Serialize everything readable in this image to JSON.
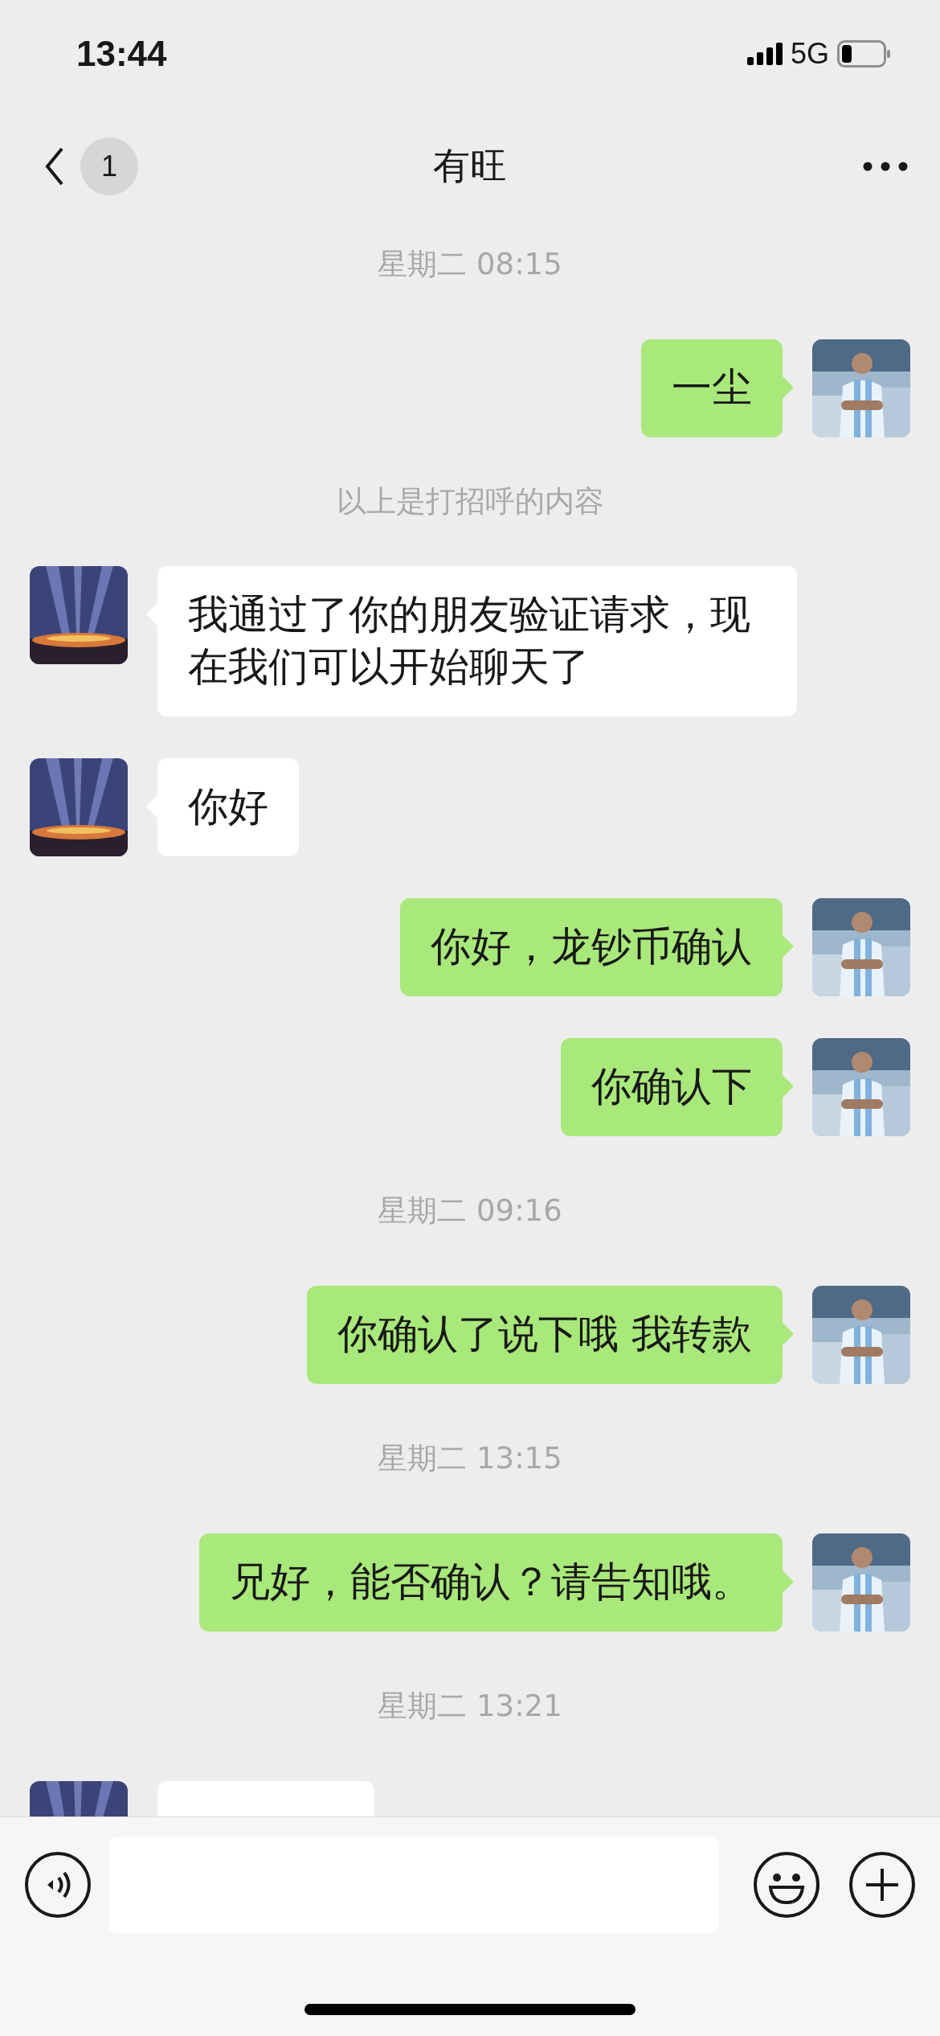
{
  "status_bar": {
    "time": "13:44",
    "network": "5G"
  },
  "header": {
    "badge": "1",
    "title": "有旺"
  },
  "messages": [
    {
      "kind": "timestamp",
      "text": "星期二 08:15"
    },
    {
      "kind": "sent",
      "text": "一尘"
    },
    {
      "kind": "notice",
      "text": "以上是打招呼的内容"
    },
    {
      "kind": "received",
      "text": "我通过了你的朋友验证请求，现在我们可以开始聊天了"
    },
    {
      "kind": "received",
      "text": "你好"
    },
    {
      "kind": "sent",
      "text": "你好，龙钞币确认"
    },
    {
      "kind": "sent",
      "text": "你确认下"
    },
    {
      "kind": "timestamp",
      "text": "星期二 09:16"
    },
    {
      "kind": "sent",
      "text": "你确认了说下哦 我转款"
    },
    {
      "kind": "timestamp",
      "text": "星期二 13:15"
    },
    {
      "kind": "sent",
      "text": "兄好，能否确认？请告知哦。"
    },
    {
      "kind": "timestamp",
      "text": "星期二 13:21"
    },
    {
      "kind": "received_cut"
    }
  ]
}
